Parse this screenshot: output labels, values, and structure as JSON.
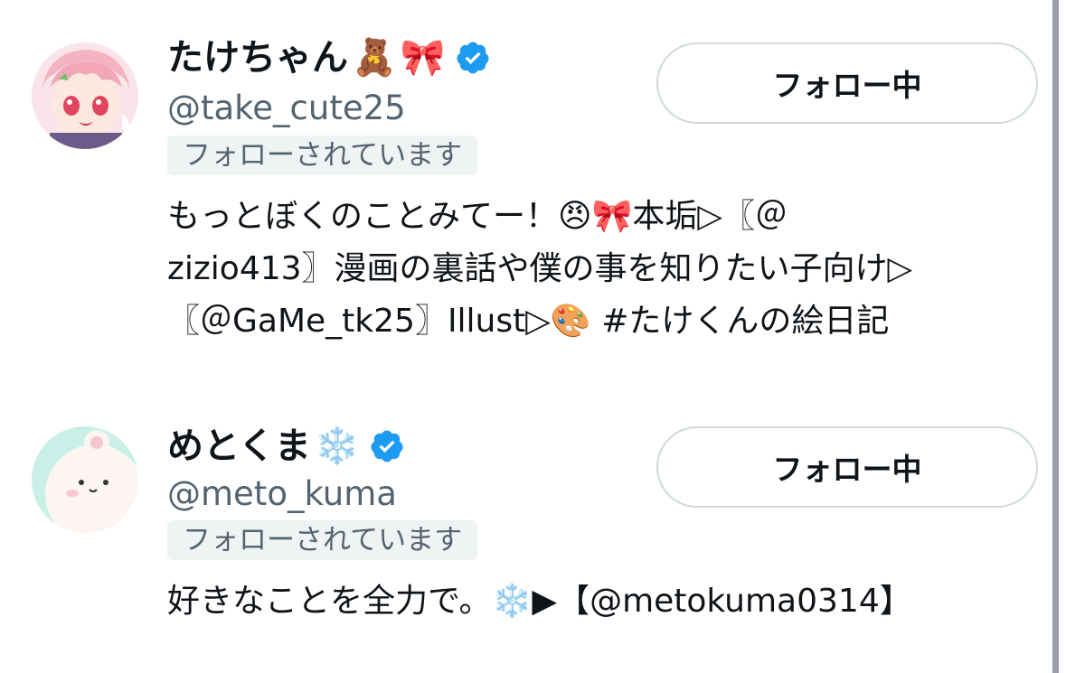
{
  "users": [
    {
      "display_name": "たけちゃん",
      "name_emoji_1": "🧸",
      "name_emoji_2": "🎀",
      "handle": "@take_cute25",
      "follows_you": "フォローされています",
      "follow_button_label": "フォロー中",
      "bio_lines": [
        "もっとぼくのことみてー！😠🎀本垢▷〖＠",
        "zizio413〗漫画の裏話や僕の事を知りたい子向け▷",
        "〖＠GaMe_tk25〗Illust▷🎨 #たけくんの絵日記"
      ],
      "avatar_icon": "anime-avatar-pink-hair"
    },
    {
      "display_name": "めとくま",
      "name_emoji_1": "❄️",
      "handle": "@meto_kuma",
      "follows_you": "フォローされています",
      "follow_button_label": "フォロー中",
      "bio_lines": [
        "好きなことを全力で。❄️▶【@metokuma0314】"
      ],
      "avatar_icon": "bear-avatar-mint"
    }
  ],
  "colors": {
    "verified_badge": "#1d9bf0",
    "secondary_text": "#536471",
    "badge_bg": "#eff3f4",
    "button_border": "#cfd9de"
  }
}
